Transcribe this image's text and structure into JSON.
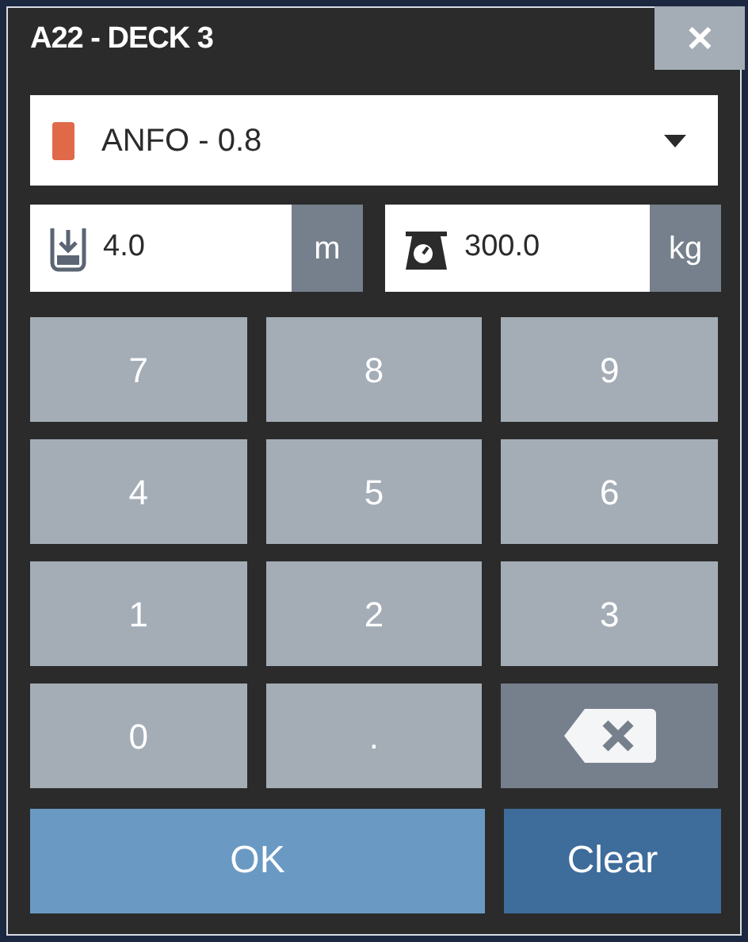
{
  "title": "A22 - DECK 3",
  "close": {
    "label": "✕"
  },
  "material": {
    "label": "ANFO - 0.8",
    "color": "#e0694a"
  },
  "fields": [
    {
      "kind": "length",
      "value": "4.0",
      "unit": "m"
    },
    {
      "kind": "weight",
      "value": "300.0",
      "unit": "kg"
    }
  ],
  "keys": [
    {
      "kind": "digit",
      "label": "7"
    },
    {
      "kind": "digit",
      "label": "8"
    },
    {
      "kind": "digit",
      "label": "9"
    },
    {
      "kind": "digit",
      "label": "4"
    },
    {
      "kind": "digit",
      "label": "5"
    },
    {
      "kind": "digit",
      "label": "6"
    },
    {
      "kind": "digit",
      "label": "1"
    },
    {
      "kind": "digit",
      "label": "2"
    },
    {
      "kind": "digit",
      "label": "3"
    },
    {
      "kind": "digit",
      "label": "0"
    },
    {
      "kind": "digit",
      "label": "."
    },
    {
      "kind": "backspace"
    }
  ],
  "buttons": [
    {
      "kind": "primary",
      "label": "OK"
    },
    {
      "kind": "secondary",
      "label": "Clear"
    }
  ]
}
